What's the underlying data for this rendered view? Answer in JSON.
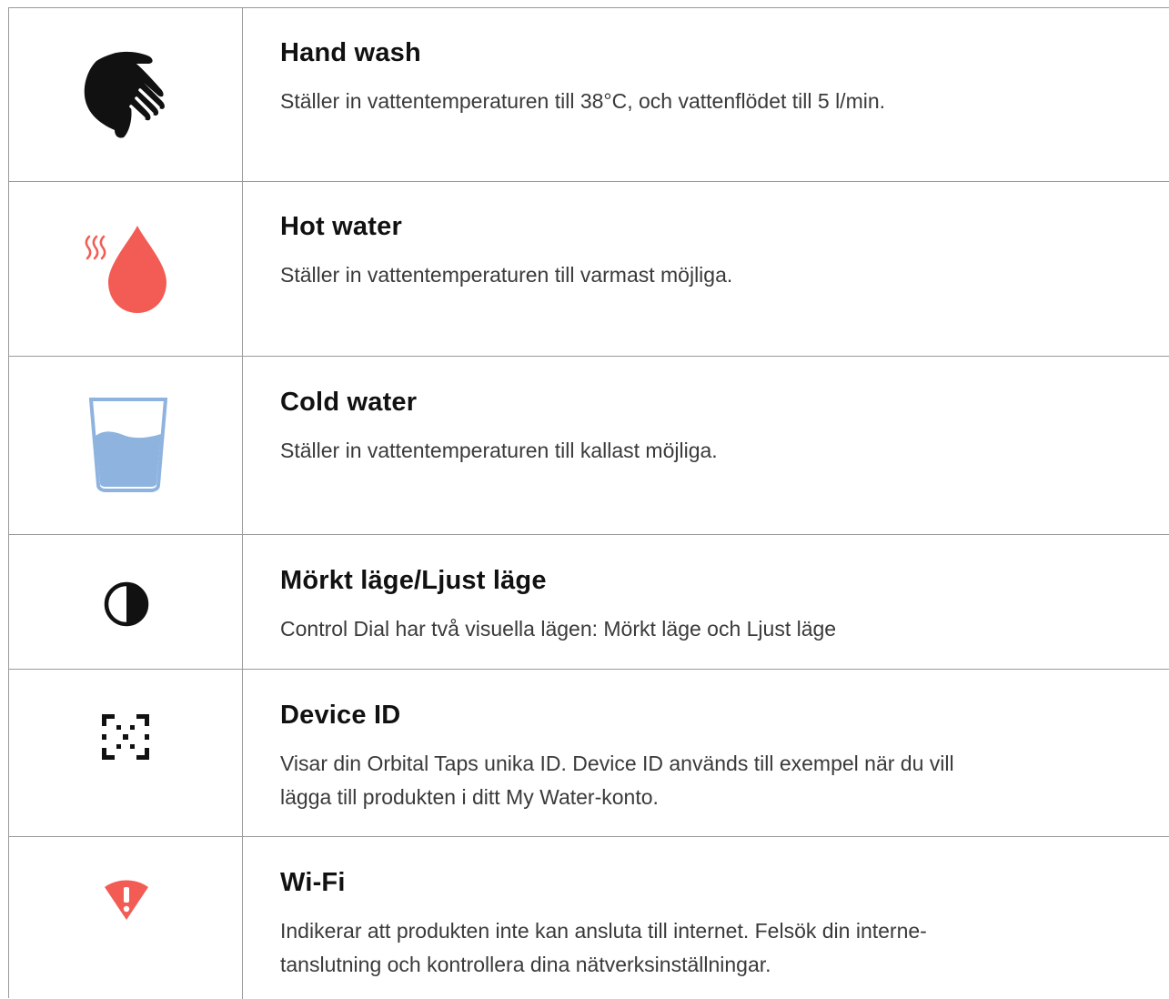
{
  "rows": [
    {
      "title": "Hand wash",
      "desc_lines": [
        "Ställer in vattentemperaturen till 38°C, och vattenflödet till 5 l/min."
      ],
      "icon": "hand-icon",
      "icon_color": "#111111"
    },
    {
      "title": "Hot water",
      "desc_lines": [
        "Ställer in vattentemperaturen till varmast möjliga."
      ],
      "icon": "hot-water-drop-icon",
      "icon_color": "#f25c54"
    },
    {
      "title": "Cold water",
      "desc_lines": [
        "Ställer in vattentemperaturen till kallast möjliga."
      ],
      "icon": "cold-water-glass-icon",
      "icon_color": "#8fb3df"
    },
    {
      "title": "Mörkt läge/Ljust läge",
      "desc_lines": [
        "Control Dial har två visuella lägen: Mörkt läge och Ljust läge"
      ],
      "icon": "contrast-icon",
      "icon_color": "#111111"
    },
    {
      "title": "Device ID",
      "desc_lines": [
        "Visar din Orbital Taps unika ID. Device ID används till exempel när du vill",
        "lägga till produkten i ditt My Water-konto."
      ],
      "icon": "device-id-scan-icon",
      "icon_color": "#111111"
    },
    {
      "title": "Wi-Fi",
      "desc_lines": [
        "Indikerar att produkten inte kan ansluta till internet. Felsök din interne-",
        "tanslutning och kontrollera dina nätverksinställningar."
      ],
      "icon": "wifi-warning-icon",
      "icon_color": "#f25c54"
    }
  ]
}
